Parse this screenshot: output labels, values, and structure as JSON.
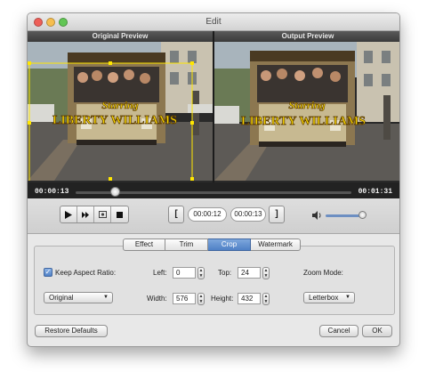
{
  "window": {
    "title": "Edit"
  },
  "colors": {
    "close": "#ee5f58",
    "minimize": "#f6be4f",
    "zoom": "#62c655",
    "accent": "#4f80c6",
    "crop_frame": "#ffe600"
  },
  "preview": {
    "original_label": "Original Preview",
    "output_label": "Output Preview",
    "caption_line1": "Starring",
    "caption_line2": "LIBERTY WILLIAMS",
    "time_current": "00:00:13",
    "time_total": "00:01:31",
    "playhead_fraction": 0.14
  },
  "controls": {
    "play_icon": "play-icon",
    "next_frame_icon": "fast-forward-icon",
    "snapshot_icon": "snapshot-icon",
    "stop_icon": "stop-icon",
    "start_bracket": "[",
    "end_bracket": "]",
    "start_time": "00:00:12",
    "end_time": "00:00:13",
    "volume_icon": "speaker-icon",
    "volume_fraction": 0.9
  },
  "tabs": [
    "Effect",
    "Trim",
    "Crop",
    "Watermark"
  ],
  "active_tab": "Crop",
  "crop": {
    "keep_aspect_label": "Keep Aspect Ratio:",
    "keep_aspect_checked": true,
    "aspect_value": "Original",
    "left_label": "Left:",
    "left_value": "0",
    "top_label": "Top:",
    "top_value": "24",
    "width_label": "Width:",
    "width_value": "576",
    "height_label": "Height:",
    "height_value": "432",
    "zoom_mode_label": "Zoom Mode:",
    "zoom_mode_value": "Letterbox"
  },
  "footer": {
    "restore_label": "Restore Defaults",
    "cancel_label": "Cancel",
    "ok_label": "OK"
  }
}
